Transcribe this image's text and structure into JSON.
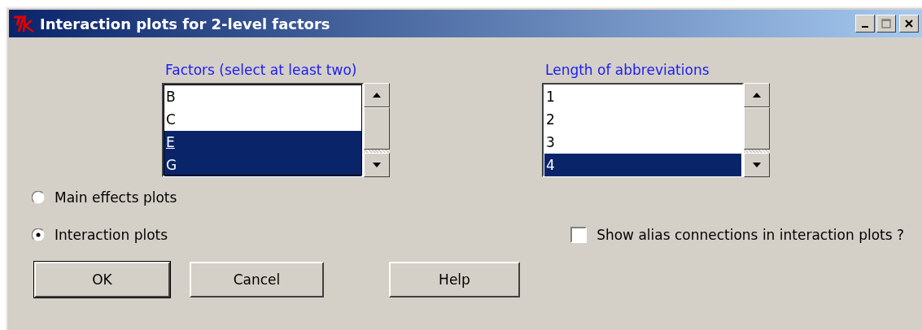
{
  "window": {
    "title": "Interaction plots for 2-level factors"
  },
  "lists": [
    {
      "label": "Factors (select at least two)",
      "items": [
        {
          "text": "B",
          "selected": false,
          "active": false
        },
        {
          "text": "C",
          "selected": false,
          "active": false
        },
        {
          "text": "E",
          "selected": true,
          "active": true
        },
        {
          "text": "G",
          "selected": true,
          "active": false
        }
      ]
    },
    {
      "label": "Length of abbreviations",
      "items": [
        {
          "text": "1",
          "selected": false,
          "active": false
        },
        {
          "text": "2",
          "selected": false,
          "active": false
        },
        {
          "text": "3",
          "selected": false,
          "active": false
        },
        {
          "text": "4",
          "selected": true,
          "active": false
        }
      ]
    }
  ],
  "plot_type": [
    {
      "label": "Main effects plots",
      "selected": false
    },
    {
      "label": "Interaction plots",
      "selected": true
    }
  ],
  "alias_checkbox": {
    "label": "Show alias connections in interaction plots ?",
    "checked": false
  },
  "buttons": [
    {
      "label": "OK",
      "default": true
    },
    {
      "label": "Cancel",
      "default": false
    },
    {
      "label": "Help",
      "default": false
    }
  ]
}
